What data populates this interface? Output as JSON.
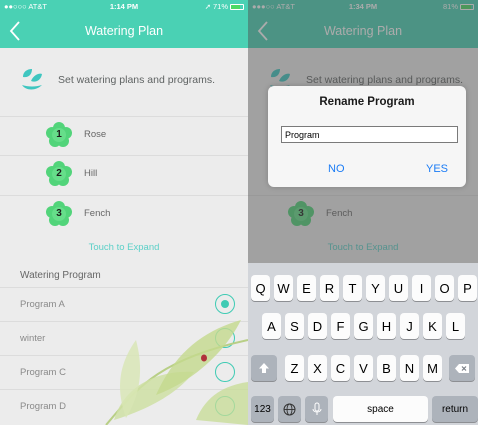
{
  "left": {
    "status": {
      "carrier": "●●○○○ AT&T",
      "time": "1:14 PM",
      "battery": "71%",
      "battery_level": 0.71
    },
    "nav_title": "Watering Plan",
    "header_text": "Set watering plans and programs.",
    "plans": [
      {
        "num": "1",
        "name": "Rose"
      },
      {
        "num": "2",
        "name": "Hill"
      },
      {
        "num": "3",
        "name": "Fench"
      }
    ],
    "expand": "Touch to Expand",
    "section_label": "Watering Program",
    "programs": [
      {
        "name": "Program A",
        "selected": true
      },
      {
        "name": "winter",
        "selected": false
      },
      {
        "name": "Program C",
        "selected": false
      },
      {
        "name": "Program D",
        "selected": false
      }
    ]
  },
  "right": {
    "status": {
      "carrier": "●●●○○ AT&T",
      "time": "1:34 PM",
      "battery": "81%",
      "battery_level": 0.81
    },
    "nav_title": "Watering Plan",
    "header_text": "Set watering plans and programs.",
    "plans": [
      {
        "num": "3",
        "name": "Fench"
      }
    ],
    "expand": "Touch to Expand",
    "dialog": {
      "title": "Rename Program",
      "input_value": "Program",
      "no_label": "NO",
      "yes_label": "YES"
    },
    "keyboard": {
      "row1": [
        "Q",
        "W",
        "E",
        "R",
        "T",
        "Y",
        "U",
        "I",
        "O",
        "P"
      ],
      "row2": [
        "A",
        "S",
        "D",
        "F",
        "G",
        "H",
        "J",
        "K",
        "L"
      ],
      "row3": [
        "Z",
        "X",
        "C",
        "V",
        "B",
        "N",
        "M"
      ],
      "numbers_label": "123",
      "space_label": "space",
      "return_label": "return"
    }
  },
  "colors": {
    "accent": "#4ad1b4",
    "alert_button": "#1b7cf5"
  }
}
